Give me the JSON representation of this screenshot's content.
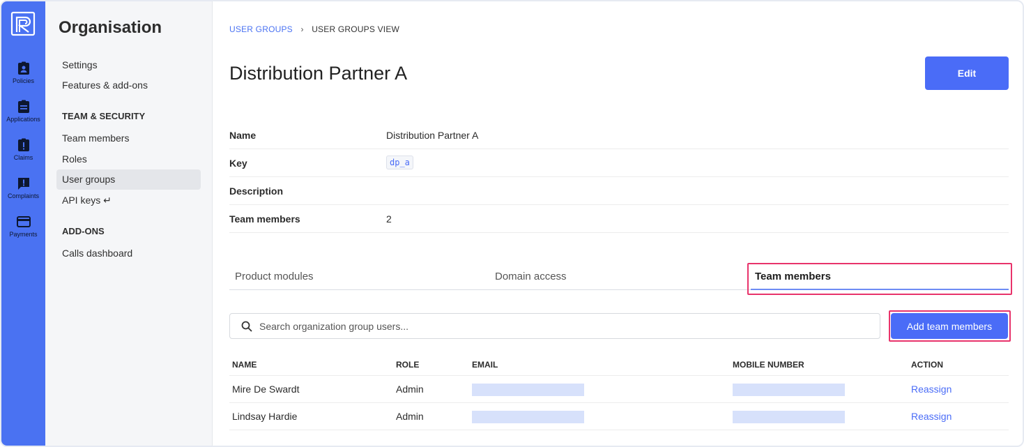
{
  "rail": {
    "items": [
      {
        "label": "Policies",
        "icon": "policies-icon"
      },
      {
        "label": "Applications",
        "icon": "clipboard-icon"
      },
      {
        "label": "Claims",
        "icon": "claims-icon"
      },
      {
        "label": "Complaints",
        "icon": "chat-alert-icon"
      },
      {
        "label": "Payments",
        "icon": "credit-card-icon"
      }
    ]
  },
  "org": {
    "title": "Organisation",
    "items": [
      "Settings",
      "Features & add-ons"
    ],
    "section_team": "TEAM & SECURITY",
    "team_items": [
      "Team members",
      "Roles",
      "User groups",
      "API keys ↵"
    ],
    "section_addons": "ADD-ONS",
    "addon_items": [
      "Calls dashboard"
    ]
  },
  "breadcrumb": {
    "parent": "USER GROUPS",
    "separator": "›",
    "current": "USER GROUPS VIEW"
  },
  "page": {
    "title": "Distribution Partner A",
    "edit_label": "Edit"
  },
  "props": [
    {
      "key": "Name",
      "value": "Distribution Partner A"
    },
    {
      "key": "Key",
      "value": "dp_a"
    },
    {
      "key": "Description",
      "value": ""
    },
    {
      "key": "Team members",
      "value": "2"
    }
  ],
  "tabs": [
    "Product modules",
    "Domain access",
    "Team members"
  ],
  "search": {
    "placeholder": "Search organization group users..."
  },
  "add_button": "Add team members",
  "table": {
    "headers": [
      "NAME",
      "ROLE",
      "EMAIL",
      "MOBILE NUMBER",
      "ACTION"
    ],
    "rows": [
      {
        "name": "Mire De Swardt",
        "role": "Admin",
        "action": "Reassign"
      },
      {
        "name": "Lindsay Hardie",
        "role": "Admin",
        "action": "Reassign"
      }
    ]
  },
  "colors": {
    "accent": "#4a6cf7",
    "rail": "#4a72f2",
    "highlight": "#e8336b"
  }
}
